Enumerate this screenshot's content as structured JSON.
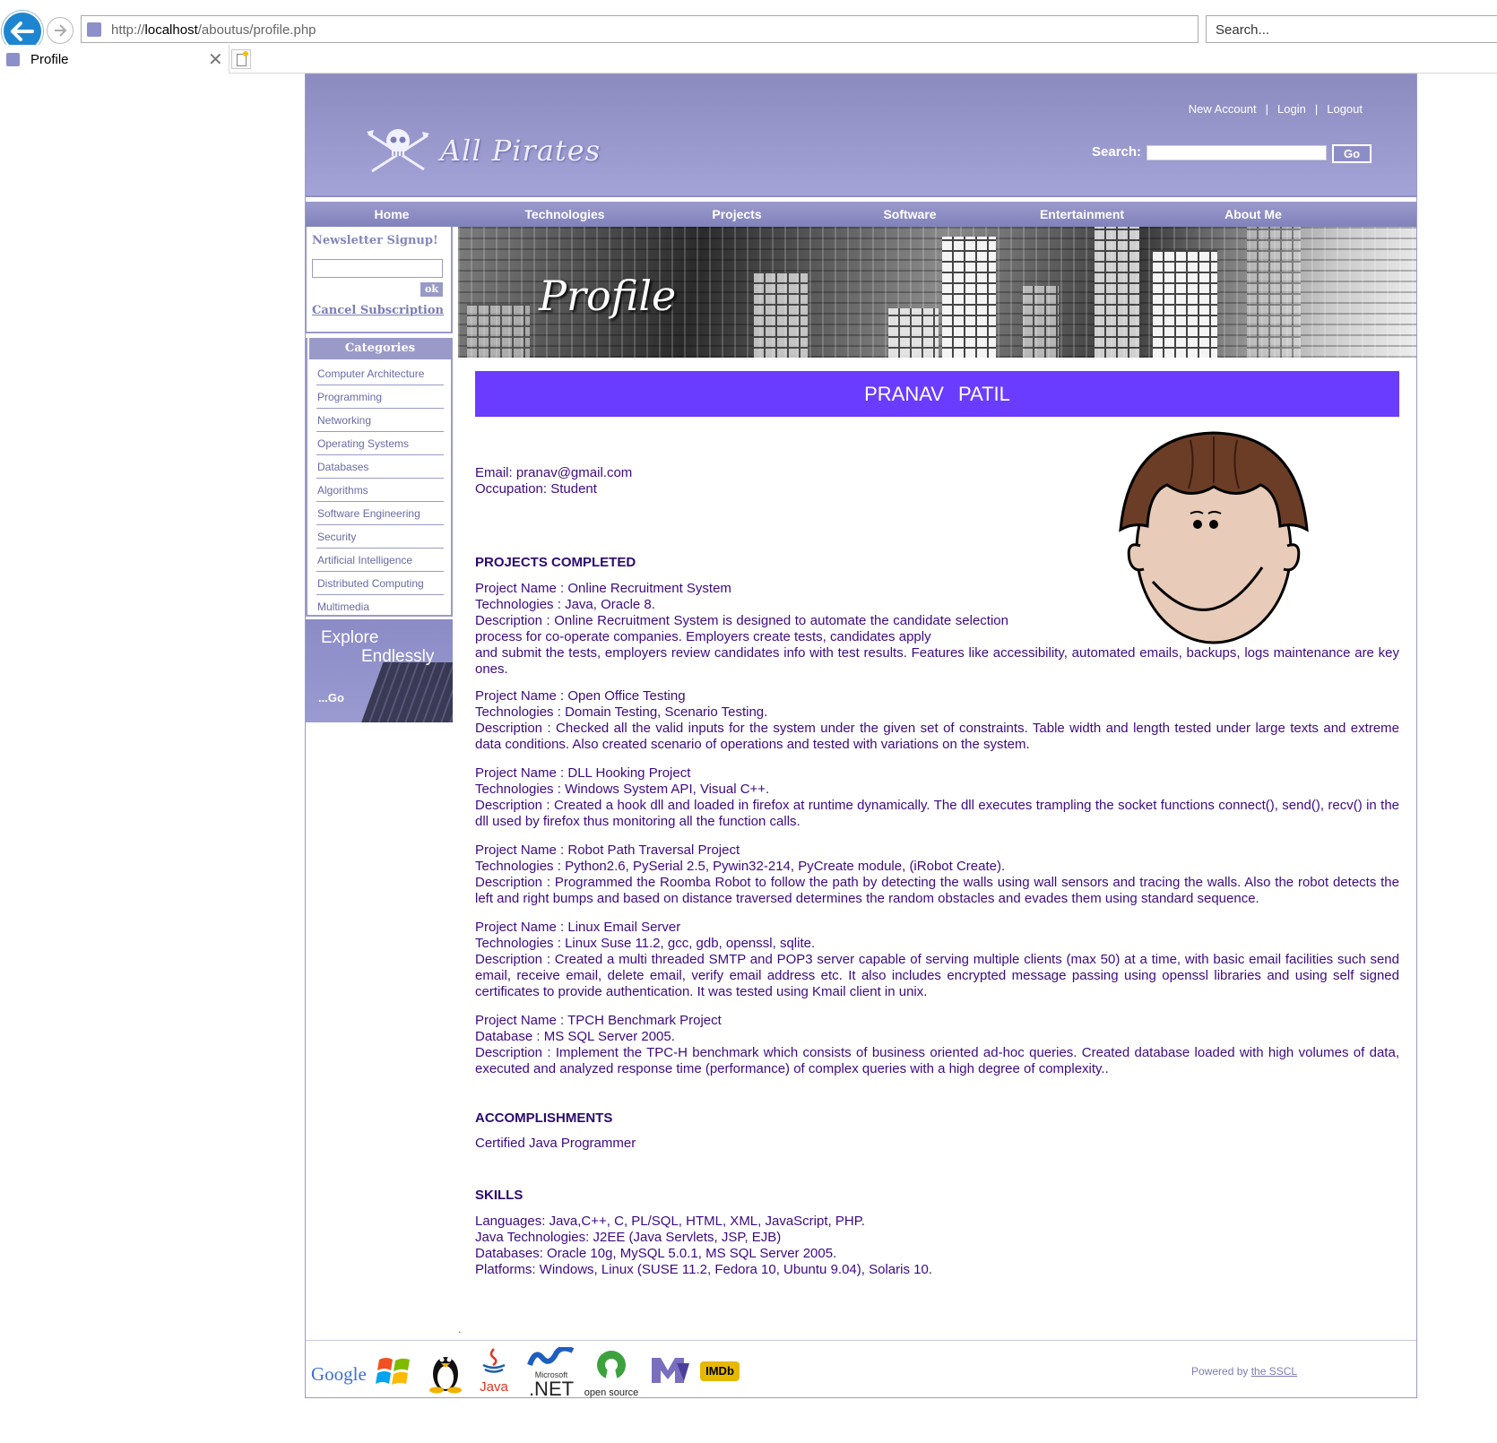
{
  "browser": {
    "url_prefix": "http://",
    "url_host": "localhost",
    "url_path": "/aboutus/profile.php",
    "search_placeholder": "Search...",
    "tab_title": "Profile"
  },
  "header": {
    "logo_text": "All Pirates",
    "links": [
      "New Account",
      "Login",
      "Logout"
    ],
    "search_label": "Search:",
    "go_label": "Go"
  },
  "nav": {
    "items": [
      "Home",
      "Technologies",
      "Projects",
      "Software",
      "Entertainment",
      "About Me"
    ]
  },
  "sidebar": {
    "newsletter_title": "Newsletter Signup!",
    "ok_label": "ok",
    "cancel_label": "Cancel Subscription",
    "categories_title": "Categories",
    "categories": [
      "Computer Architecture",
      "Programming",
      "Networking",
      "Operating Systems",
      "Databases",
      "Algorithms",
      "Software Engineering",
      "Security",
      "Artificial Intelligence",
      "Distributed Computing",
      "Multimedia"
    ],
    "explore_line1": "Explore",
    "explore_line2": "Endlessly",
    "explore_go": "...Go"
  },
  "banner": {
    "title": "Profile"
  },
  "profile": {
    "name": "PRANAV PATIL",
    "email": "Email: pranav@gmail.com",
    "occupation": "Occupation: Student"
  },
  "projects": {
    "title": "PROJECTS COMPLETED",
    "items": [
      {
        "name": "Project Name : Online Recruitment System",
        "tech": "Technologies : Java, Oracle 8.",
        "desc_a": "Description : Online Recruitment System is designed to automate the candidate selection process for co-operate companies. Employers create tests, candidates apply",
        "desc_b": "and submit the tests, employers review candidates info with test results. Features like accessibility, automated emails, backups, logs maintenance are key ones."
      },
      {
        "name": "Project Name : Open Office Testing",
        "tech": "Technologies : Domain Testing, Scenario Testing.",
        "desc": "Description : Checked all the valid inputs for the system under the given set of constraints. Table width and length tested under large texts and extreme data conditions. Also created scenario of operations and tested with variations on the system."
      },
      {
        "name": "Project Name : DLL Hooking Project",
        "tech": "Technologies : Windows System API, Visual C++.",
        "desc": "Description : Created a hook dll and loaded in firefox at runtime dynamically. The dll executes trampling the socket functions connect(), send(), recv() in the dll used by firefox thus monitoring all the function calls."
      },
      {
        "name": "Project Name : Robot Path Traversal Project",
        "tech": "Technologies : Python2.6, PySerial 2.5, Pywin32-214, PyCreate module, (iRobot Create).",
        "desc": "Description : Programmed the Roomba Robot to follow the path by detecting the walls using wall sensors and tracing the walls. Also the robot detects the left and right bumps and based on distance traversed determines the random obstacles and evades them using standard sequence."
      },
      {
        "name": "Project Name : Linux Email Server",
        "tech": "Technologies : Linux Suse 11.2, gcc, gdb, openssl, sqlite.",
        "desc": "Description : Created a multi threaded SMTP and POP3 server capable of serving multiple clients (max 50) at a time, with basic email facilities such send email, receive email, delete email, verify email address etc. It also includes encrypted message passing using openssl libraries and using self signed certificates to provide authentication. It was tested using Kmail client in unix."
      },
      {
        "name": "Project Name : TPCH Benchmark Project",
        "tech": "Database : MS SQL Server 2005.",
        "desc": "Description : Implement the TPC-H benchmark which consists of business oriented ad-hoc queries. Created database loaded with high volumes of data, executed and analyzed response time (performance) of complex queries with a high degree of complexity.."
      }
    ]
  },
  "accomplishments": {
    "title": "ACCOMPLISHMENTS",
    "text": "Certified Java Programmer"
  },
  "skills": {
    "title": "SKILLS",
    "lines": [
      "Languages: Java,C++, C, PL/SQL, HTML, XML, JavaScript, PHP.",
      "Java Technologies: J2EE (Java Servlets, JSP, EJB)",
      "Databases: Oracle 10g, MySQL 5.0.1, MS SQL Server 2005.",
      "Platforms: Windows, Linux (SUSE 11.2, Fedora 10, Ubuntu 9.04), Solaris 10."
    ]
  },
  "footer": {
    "dot": ".",
    "powered_prefix": "Powered by",
    "powered_link": "the SSCL",
    "logos": {
      "google": "Google",
      "java": "Java",
      "net_small": "Microsoft",
      "net_big": ".NET",
      "opensource": "open source",
      "imdb": "IMDb"
    }
  }
}
